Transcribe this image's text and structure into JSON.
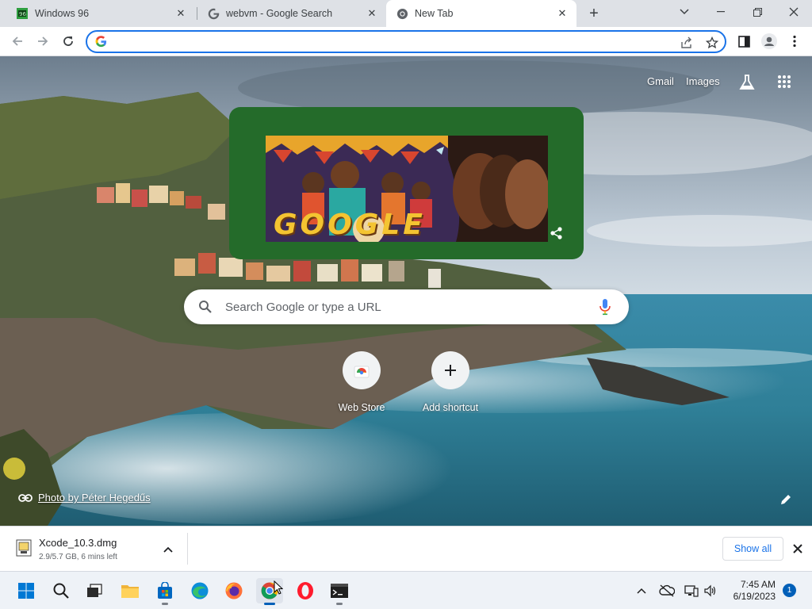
{
  "tabs": [
    {
      "title": "Windows 96",
      "icon": "windows96-icon",
      "active": false
    },
    {
      "title": "webvm - Google Search",
      "icon": "google-icon",
      "active": false
    },
    {
      "title": "New Tab",
      "icon": "chrome-icon",
      "active": true
    }
  ],
  "toolbar": {
    "omnibox_value": ""
  },
  "ntp": {
    "gmail_label": "Gmail",
    "images_label": "Images",
    "search_placeholder": "Search Google or type a URL",
    "doodle_text": "GOOGLE",
    "shortcuts": [
      {
        "label": "Web Store",
        "icon": "web-store-icon"
      },
      {
        "label": "Add shortcut",
        "icon": "plus-icon"
      }
    ],
    "photo_credit": "Photo by Péter Hegedűs"
  },
  "download_shelf": {
    "file_name": "Xcode_10.3.dmg",
    "status": "2.9/5.7 GB, 6 mins left",
    "show_all_label": "Show all"
  },
  "taskbar": {
    "time": "7:45 AM",
    "date": "6/19/2023",
    "notification_count": "1"
  },
  "colors": {
    "accent": "#1a73e8",
    "doodle_bg": "#246b2a",
    "taskbar_accent": "#005fb8"
  }
}
